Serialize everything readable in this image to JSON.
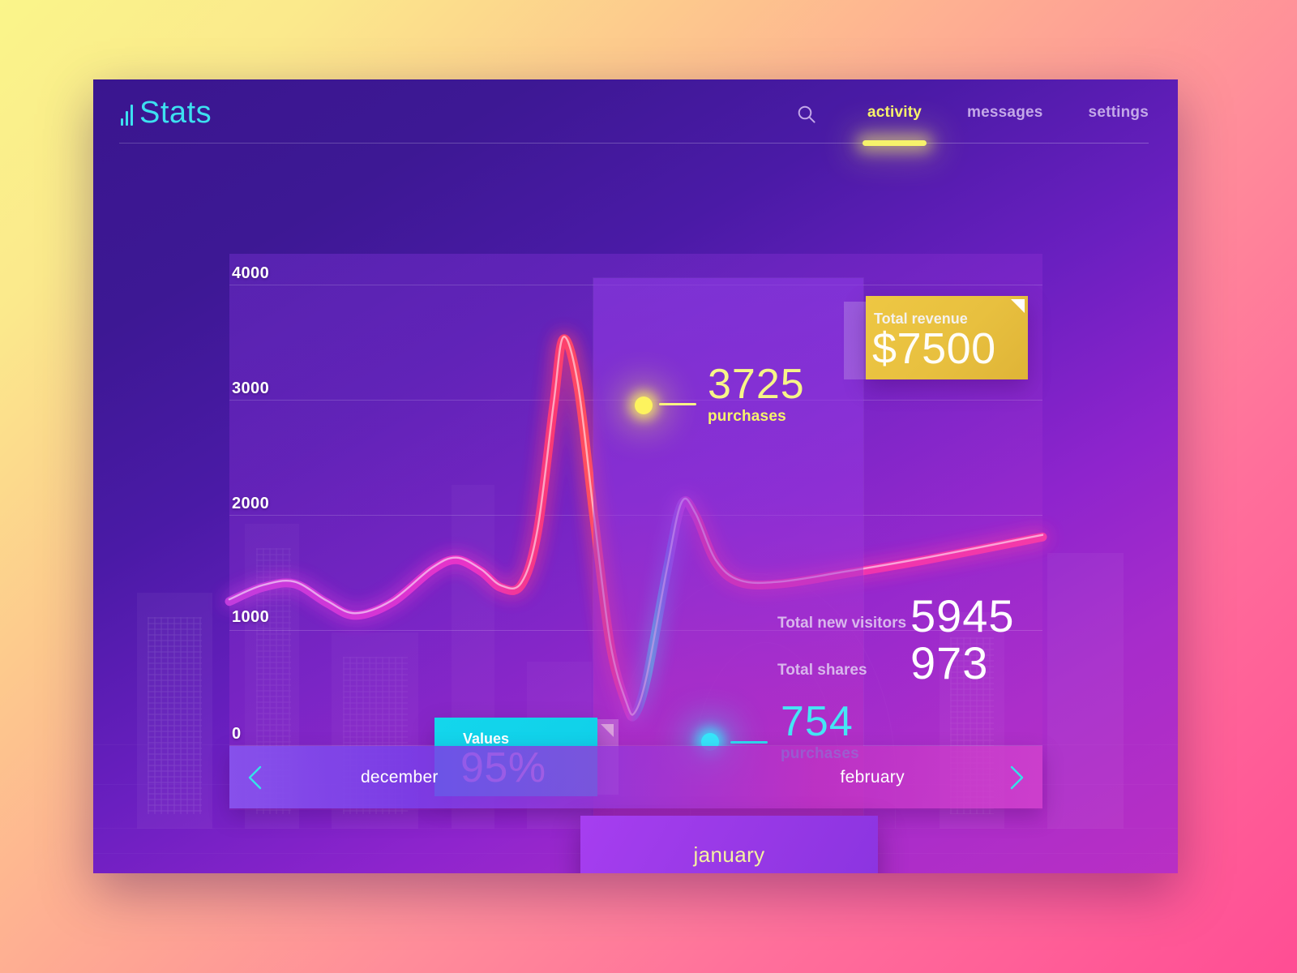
{
  "header": {
    "logo_text": "Stats",
    "nav": [
      {
        "label": "activity",
        "active": true
      },
      {
        "label": "messages",
        "active": false
      },
      {
        "label": "settings",
        "active": false
      }
    ]
  },
  "revenue_card": {
    "title": "Total revenue",
    "value": "$7500",
    "color": "#e8c03f"
  },
  "values_card": {
    "title": "Values",
    "value": "95%",
    "color": "#11d2ea"
  },
  "stats": [
    {
      "label": "Total new visitors",
      "value": "5945"
    },
    {
      "label": "Total shares",
      "value": "973"
    }
  ],
  "callouts": [
    {
      "value": "3725",
      "unit": "purchases",
      "color": "#f6f36b"
    },
    {
      "value": "754",
      "unit": "purchases",
      "color": "#2fd9ef"
    }
  ],
  "month_nav": {
    "prev_label": "december",
    "current_label": "january",
    "next_label": "february"
  },
  "chart_data": {
    "type": "line",
    "title": "",
    "xlabel": "",
    "ylabel": "",
    "ylim": [
      0,
      4400
    ],
    "grid": true,
    "legend": "none",
    "ytick_labels": [
      "4000",
      "3000",
      "2000",
      "1000",
      "0"
    ],
    "ytick_values": [
      4000,
      3000,
      2000,
      1000,
      0
    ],
    "categories": [
      "december",
      "january",
      "february"
    ],
    "selected_category": "january",
    "annotations": [
      {
        "label": "3725 purchases",
        "value": 3725,
        "marker_color": "#fdf35e",
        "position": "peak"
      },
      {
        "label": "754 purchases",
        "value": 754,
        "marker_color": "#36e6fb",
        "position": "trough"
      }
    ],
    "series": [
      {
        "name": "purchases",
        "color": "#ea33c0",
        "points": [
          {
            "x": 0,
            "y": 1650
          },
          {
            "x": 40,
            "y": 1760
          },
          {
            "x": 80,
            "y": 1790
          },
          {
            "x": 120,
            "y": 1640
          },
          {
            "x": 155,
            "y": 1540
          },
          {
            "x": 200,
            "y": 1640
          },
          {
            "x": 250,
            "y": 1900
          },
          {
            "x": 280,
            "y": 1980
          },
          {
            "x": 310,
            "y": 1890
          },
          {
            "x": 335,
            "y": 1760
          },
          {
            "x": 360,
            "y": 1780
          },
          {
            "x": 380,
            "y": 2200
          },
          {
            "x": 400,
            "y": 3200
          },
          {
            "x": 412,
            "y": 3725
          },
          {
            "x": 430,
            "y": 3350
          },
          {
            "x": 450,
            "y": 2300
          },
          {
            "x": 470,
            "y": 1300
          },
          {
            "x": 490,
            "y": 830
          },
          {
            "x": 500,
            "y": 754
          },
          {
            "x": 515,
            "y": 1050
          },
          {
            "x": 540,
            "y": 1900
          },
          {
            "x": 558,
            "y": 2420
          },
          {
            "x": 575,
            "y": 2330
          },
          {
            "x": 600,
            "y": 1960
          },
          {
            "x": 630,
            "y": 1800
          },
          {
            "x": 680,
            "y": 1790
          },
          {
            "x": 760,
            "y": 1870
          },
          {
            "x": 860,
            "y": 1980
          },
          {
            "x": 1003,
            "y": 2160
          }
        ]
      }
    ]
  }
}
